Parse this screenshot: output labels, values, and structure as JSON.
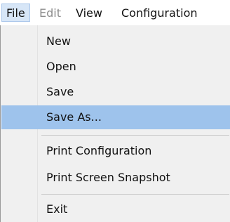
{
  "menubar": {
    "items": [
      {
        "label": "File"
      },
      {
        "label": "Edit"
      },
      {
        "label": "View"
      },
      {
        "label": "Configuration"
      }
    ]
  },
  "file_menu": {
    "items": [
      {
        "label": "New"
      },
      {
        "label": "Open"
      },
      {
        "label": "Save"
      },
      {
        "label": "Save As..."
      },
      {
        "label": "Print Configuration"
      },
      {
        "label": "Print Screen Snapshot"
      },
      {
        "label": "Exit"
      }
    ]
  },
  "colors": {
    "highlight": "#9ec3ec",
    "menu_background": "#f0f0f0",
    "disabled_text": "#8c8c8c"
  }
}
